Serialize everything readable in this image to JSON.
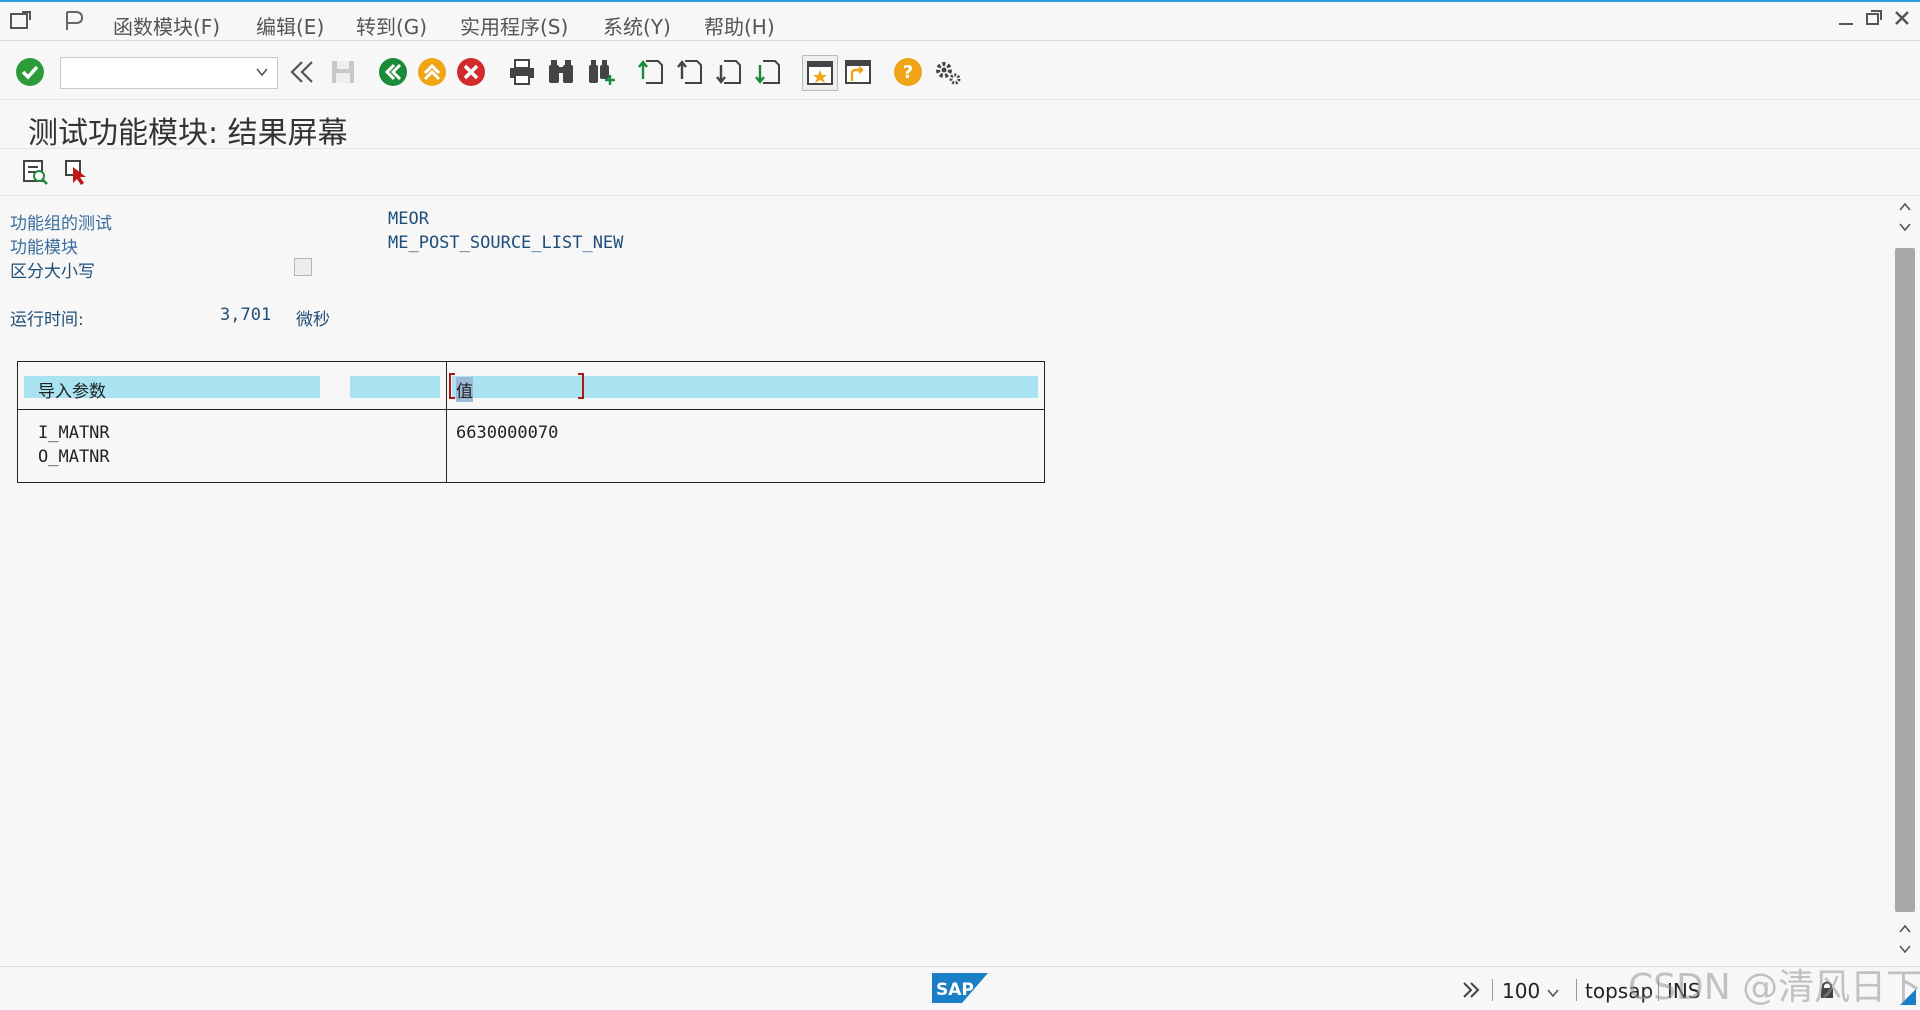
{
  "menu": {
    "items": [
      "函数模块(F)",
      "编辑(E)",
      "转到(G)",
      "实用程序(S)",
      "系统(Y)",
      "帮助(H)"
    ]
  },
  "toolbar": {
    "command_field_value": ""
  },
  "page": {
    "title": "测试功能模块: 结果屏幕"
  },
  "info": {
    "function_group_label": "功能组的测试",
    "function_group_value": "MEOR",
    "function_module_label": "功能模块",
    "function_module_value": "ME_POST_SOURCE_LIST_NEW",
    "case_sensitive_label": "区分大小写",
    "runtime_label": "运行时间:",
    "runtime_value": "3,701",
    "runtime_unit": "微秒"
  },
  "table": {
    "header_param": "导入参数",
    "header_value": "值",
    "rows": [
      {
        "param": "I_MATNR",
        "value": "6630000070"
      },
      {
        "param": "O_MATNR",
        "value": ""
      }
    ]
  },
  "status": {
    "zoom": "100",
    "user": "topsap",
    "mode": "INS",
    "brand": "SAP"
  },
  "watermark": "CSDN @清风日下",
  "colors": {
    "accent": "#2aa0d8",
    "header_highlight": "#a9e3f2",
    "label_blue": "#3b6c9e"
  }
}
